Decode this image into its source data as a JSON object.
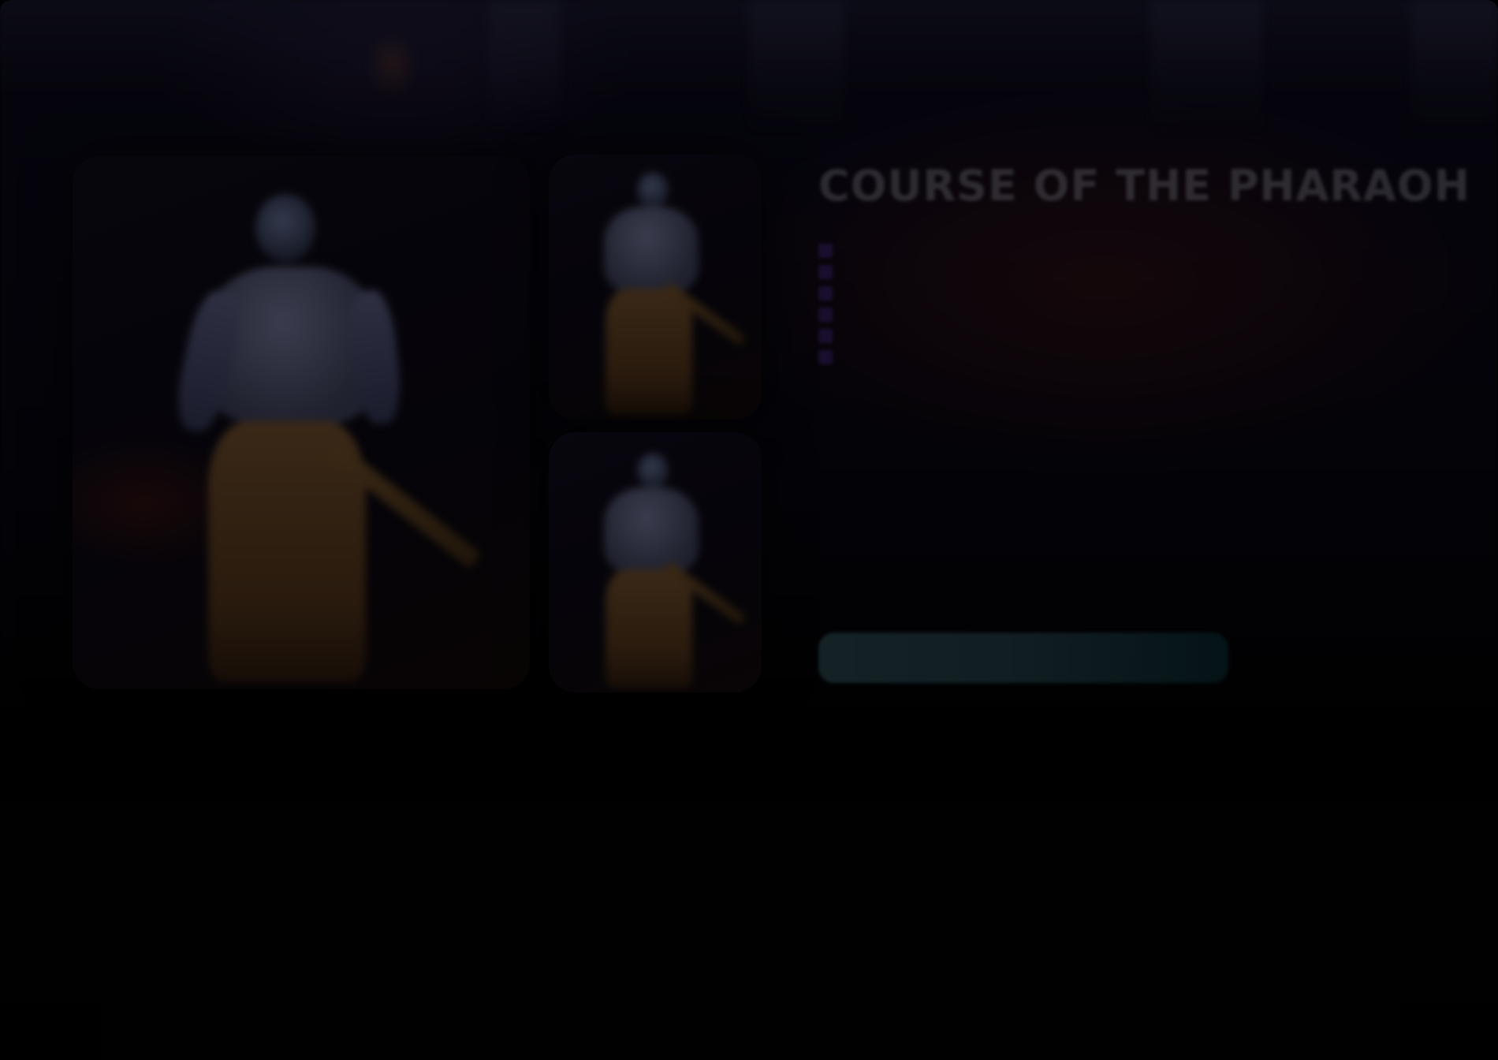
{
  "offer": {
    "title": "COURSE OF THE PHARAOH",
    "description": "",
    "subheading": "",
    "features": [
      "",
      "",
      "",
      "",
      "",
      ""
    ],
    "cta_label": ""
  },
  "colors": {
    "background": "#000000",
    "accent_bullet": "#4b2a8a",
    "cta_gradient_start": "#2c4a52",
    "cta_gradient_end": "#0b2a30"
  }
}
